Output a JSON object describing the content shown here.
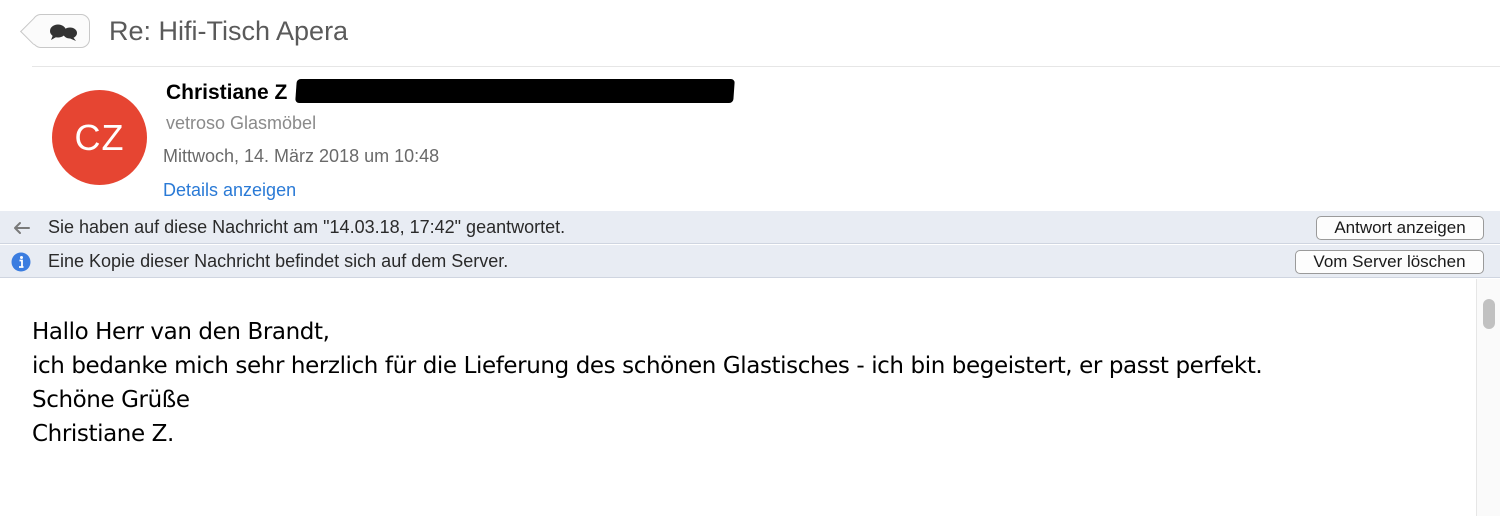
{
  "header": {
    "subject": "Re: Hifi-Tisch Apera",
    "thread_icon": "conversation-bubbles-icon"
  },
  "sender": {
    "avatar_initials": "CZ",
    "avatar_color": "#e64532",
    "name": "Christiane Z",
    "organization": "vetroso Glasmöbel",
    "date": "Mittwoch, 14. März 2018 um 10:48",
    "details_link": "Details anzeigen"
  },
  "infobars": {
    "replied": {
      "icon": "reply-arrow-icon",
      "text": "Sie haben auf diese Nachricht am \"14.03.18, 17:42\" geantwortet.",
      "button": "Antwort anzeigen"
    },
    "server_copy": {
      "icon": "info-icon",
      "text": "Eine Kopie dieser Nachricht befindet sich auf dem Server.",
      "button": "Vom Server löschen"
    }
  },
  "message": {
    "lines": [
      "Hallo Herr van den Brandt,",
      "ich bedanke mich sehr herzlich für die Lieferung des schönen Glastisches - ich bin begeistert, er passt perfekt.",
      "Schöne Grüße",
      "Christiane Z."
    ]
  },
  "colors": {
    "link": "#2a7ad6",
    "infobar_bg": "#e8ecf3",
    "info_icon": "#3b7de0"
  }
}
